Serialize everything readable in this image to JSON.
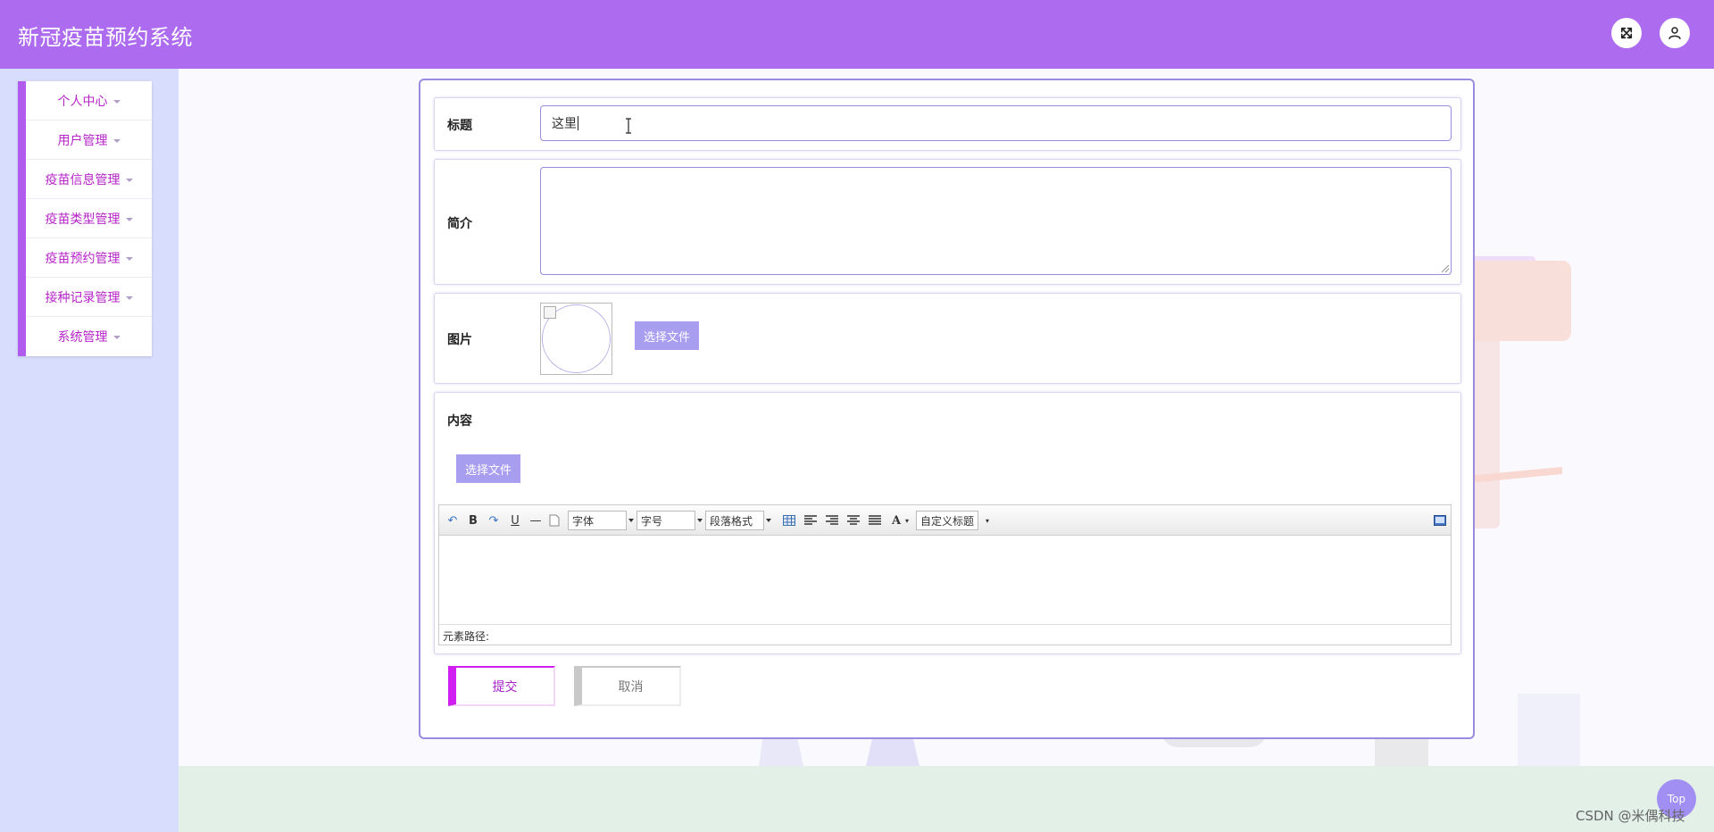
{
  "app": {
    "title": "新冠疫苗预约系统"
  },
  "header": {
    "fullscreen_icon": "expand-icon",
    "user_icon": "user-icon"
  },
  "sidebar": {
    "items": [
      {
        "label": "个人中心"
      },
      {
        "label": "用户管理"
      },
      {
        "label": "疫苗信息管理"
      },
      {
        "label": "疫苗类型管理"
      },
      {
        "label": "疫苗预约管理"
      },
      {
        "label": "接种记录管理"
      },
      {
        "label": "系统管理"
      }
    ]
  },
  "form": {
    "title_label": "标题",
    "title_value": "这里",
    "intro_label": "简介",
    "intro_value": "",
    "image_label": "图片",
    "image_upload_label": "选择文件",
    "content_label": "内容",
    "content_upload_label": "选择文件",
    "editor": {
      "font_family": "字体",
      "font_size": "字号",
      "paragraph": "段落格式",
      "custom_title": "自定义标题",
      "path_label": "元素路径:"
    },
    "submit_label": "提交",
    "cancel_label": "取消"
  },
  "floating": {
    "top_label": "Top"
  },
  "watermark": "CSDN @米偶科技",
  "colors": {
    "header": "#ad6cef",
    "accent": "#b15bee",
    "menu_text": "#b624c7",
    "button": "#a89ef0"
  }
}
